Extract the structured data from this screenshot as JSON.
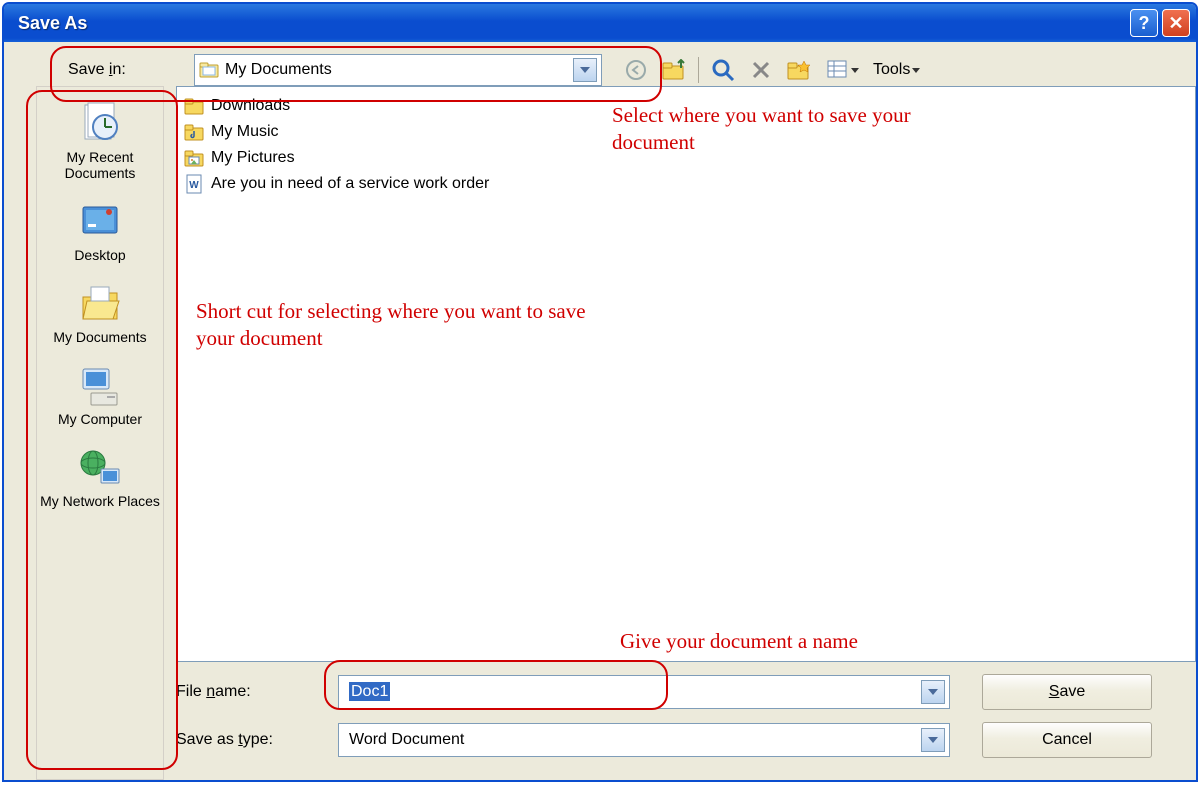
{
  "window": {
    "title": "Save As"
  },
  "save_in": {
    "label": "Save in:",
    "value": "My Documents"
  },
  "toolbar": {
    "tools_label": "Tools"
  },
  "places": [
    {
      "label": "My Recent Documents",
      "icon": "recent"
    },
    {
      "label": "Desktop",
      "icon": "desktop"
    },
    {
      "label": "My Documents",
      "icon": "mydocs"
    },
    {
      "label": "My Computer",
      "icon": "mycomputer"
    },
    {
      "label": "My Network Places",
      "icon": "network"
    }
  ],
  "files": [
    {
      "name": "Downloads",
      "icon": "folder"
    },
    {
      "name": "My Music",
      "icon": "folder-music"
    },
    {
      "name": "My Pictures",
      "icon": "folder-pictures"
    },
    {
      "name": "Are you in need of a service work order",
      "icon": "word-doc"
    }
  ],
  "filename": {
    "label_html": "File name:",
    "underline": "n",
    "value": "Doc1"
  },
  "savetype": {
    "label_html": "Save as type:",
    "underline": "t",
    "value": "Word Document"
  },
  "buttons": {
    "save": "Save",
    "save_underline": "S",
    "cancel": "Cancel"
  },
  "annotations": {
    "a1": "Select where you want to save your document",
    "a2": "Short cut for selecting where you want to save your document",
    "a3": "Give your document a name"
  }
}
